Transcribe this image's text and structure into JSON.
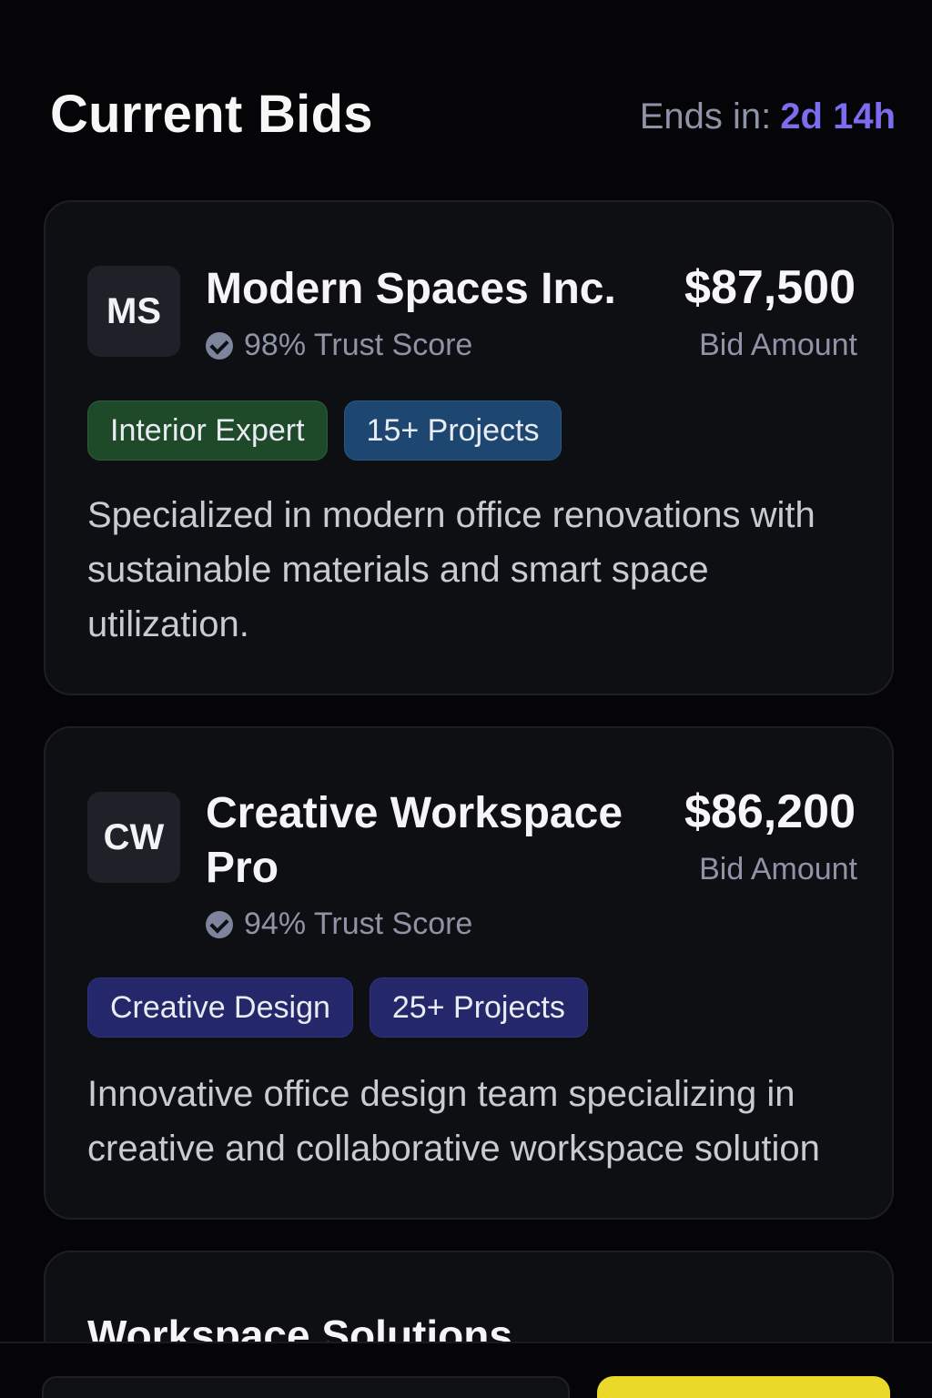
{
  "header": {
    "title": "Current Bids",
    "ends_label": "Ends in:",
    "ends_time": "2d 14h"
  },
  "bids": [
    {
      "initials": "MS",
      "name": "Modern Spaces Inc.",
      "trust": "98% Trust Score",
      "amount": "$87,500",
      "amount_label": "Bid Amount",
      "tags": [
        "Interior Expert",
        "15+ Projects"
      ],
      "description": "Specialized in modern office renovations with sustainable materials and smart space utilization."
    },
    {
      "initials": "CW",
      "name": "Creative Workspace Pro",
      "trust": "94% Trust Score",
      "amount": "$86,200",
      "amount_label": "Bid Amount",
      "tags": [
        "Creative Design",
        "25+ Projects"
      ],
      "description": "Innovative office design team specializing in creative and collaborative workspace solution"
    },
    {
      "name": "Workspace Solutions"
    }
  ],
  "colors": {
    "accent": "#7c6cf0",
    "tag_green": "#1f4a2a",
    "tag_blue": "#1d4670",
    "tag_indigo": "#24286a",
    "cta": "#ebd92a"
  }
}
